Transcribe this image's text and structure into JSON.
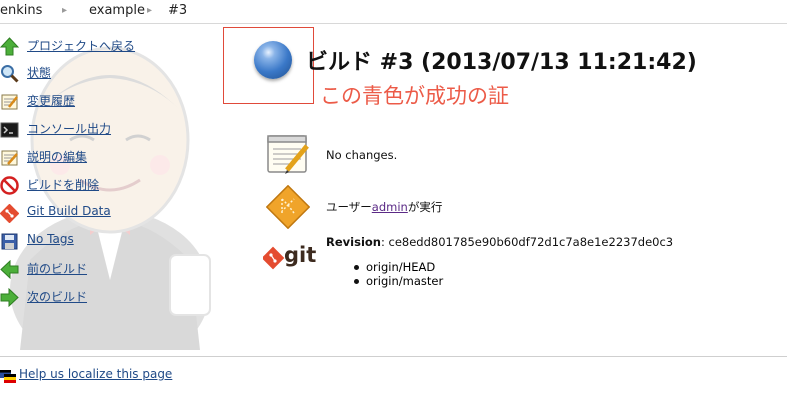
{
  "breadcrumbs": [
    {
      "label": "enkins"
    },
    {
      "label": "example"
    },
    {
      "label": "#3"
    }
  ],
  "sidebar": {
    "items": [
      {
        "label": "プロジェクトへ戻る",
        "icon": "up-arrow-icon"
      },
      {
        "label": "状態",
        "icon": "magnifier-icon"
      },
      {
        "label": "変更履歴",
        "icon": "notepad-icon"
      },
      {
        "label": "コンソール出力",
        "icon": "terminal-icon"
      },
      {
        "label": "説明の編集",
        "icon": "notepad-edit-icon"
      },
      {
        "label": "ビルドを削除",
        "icon": "no-entry-icon"
      },
      {
        "label": "Git Build Data",
        "icon": "git-icon"
      },
      {
        "label": "No Tags",
        "icon": "floppy-disk-icon"
      },
      {
        "label": "前のビルド",
        "icon": "left-arrow-icon"
      },
      {
        "label": "次のビルド",
        "icon": "right-arrow-icon"
      }
    ]
  },
  "build": {
    "title": "ビルド #3 (2013/07/13 11:21:42)",
    "status_color": "#3a78c8",
    "annotation": "この青色が成功の証"
  },
  "details": {
    "changes": "No changes.",
    "started_by_prefix": "ユーザー",
    "started_by_user": "admin",
    "started_by_suffix": "が実行",
    "revision_label": "Revision",
    "revision_sep": ": ",
    "revision_value": "ce8edd801785e90b60df72d1c7a8e1e2237de0c3",
    "branches": [
      "origin/HEAD",
      "origin/master"
    ],
    "git_logo_text": "git"
  },
  "footer": {
    "localize_link": "Help us localize this page"
  },
  "colors": {
    "link": "#204a87",
    "annotation": "#ec5b48",
    "git_orange": "#e44c30"
  }
}
